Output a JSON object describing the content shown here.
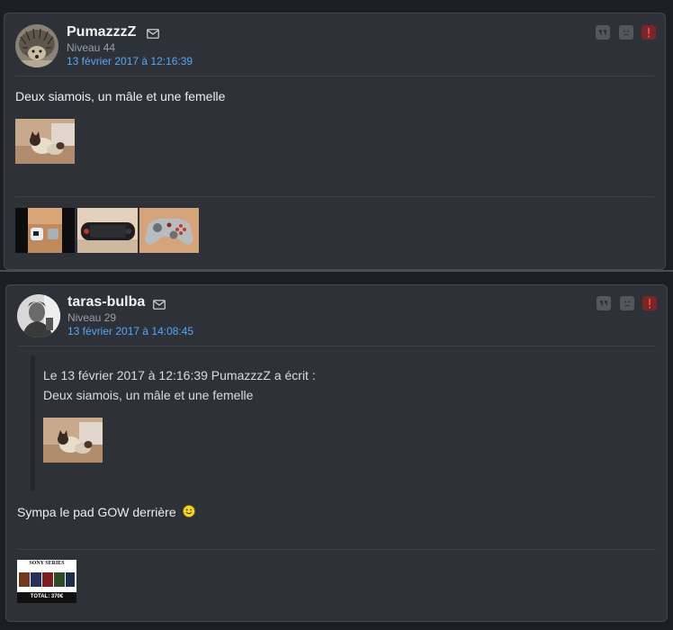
{
  "posts": [
    {
      "username": "PumazzzZ",
      "level": "Niveau 44",
      "date": "13 février 2017 à 12:16:39",
      "message": "Deux siamois, un mâle et une femelle",
      "avatar_icon": "hedgehog-avatar",
      "images": [
        "cats-photo"
      ],
      "signature_images": [
        "console-photo",
        "handheld-controller-photo",
        "gow-gamepad-photo"
      ],
      "actions": [
        "quote-icon",
        "ban-icon",
        "report-icon"
      ]
    },
    {
      "username": "taras-bulba",
      "level": "Niveau 29",
      "date": "13 février 2017 à 14:08:45",
      "quote": {
        "header": "Le 13 février 2017 à 12:16:39 PumazzzZ a écrit :",
        "text": "Deux siamois, un mâle et une femelle",
        "images": [
          "cats-photo"
        ]
      },
      "message": "Sympa le pad GOW derrière",
      "smiley": "smiley-icon",
      "avatar_icon": "portrait-avatar",
      "signature_images": [
        "sony-ps-collection-banner"
      ],
      "signature_banner": {
        "title": "SONY SERIES",
        "total": "TOTAL: 370€"
      },
      "actions": [
        "quote-icon",
        "ban-icon",
        "report-icon"
      ]
    }
  ],
  "colors": {
    "background": "#1b1e23",
    "post_background": "#2e3138",
    "date_link": "#56a8f5",
    "report": "#7a2629"
  }
}
